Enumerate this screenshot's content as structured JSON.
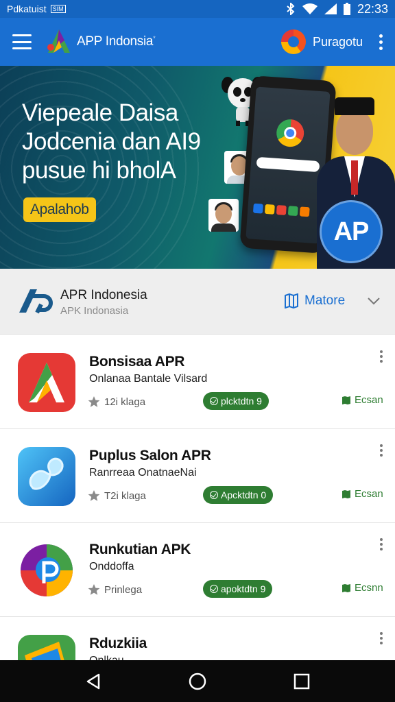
{
  "status_bar": {
    "carrier": "Pdkatuist",
    "sim_label": "SIM",
    "time": "22:33"
  },
  "app_bar": {
    "title": "APP Indonsia",
    "title_mark": "*",
    "user_name": "Puragotu"
  },
  "banner": {
    "headline": [
      "Viepeale Daisa",
      "Jodcenia dan AI9",
      "pusue hi bholA"
    ],
    "cta_label": "Apalahob",
    "badge_label": "AP"
  },
  "publisher": {
    "name": "APR Indonesia",
    "subtitle": "APK Indonasia",
    "more_label": "Matore"
  },
  "apps": [
    {
      "name": "Bonsisaa APR",
      "subtitle": "Onlanaa Bantale Vilsard",
      "rating": "12i klaga",
      "install": "plcktdtn 9",
      "action": "Ecsan",
      "accent": "#e53935"
    },
    {
      "name": "Puplus Salon APR",
      "subtitle": "Ranrreaa OnatnaeNai",
      "rating": "T2i klaga",
      "install": "Apcktdtn 0",
      "action": "Ecsan",
      "accent": "#1e88e5"
    },
    {
      "name": "Runkutian APK",
      "subtitle": "Onddoffa",
      "rating": "Prinlega",
      "install": "apoktdtn 9",
      "action": "Ecsnn",
      "accent": "#7b1fa2"
    },
    {
      "name": "Rduzkiia",
      "subtitle": "Onlkau",
      "rating": "",
      "install": "",
      "action": "",
      "accent": "#43a047"
    }
  ],
  "colors": {
    "primary": "#1a6fd1",
    "install_green": "#2e7d32",
    "banner_yellow": "#f5c518"
  },
  "icons": [
    "menu-icon",
    "logo-icon",
    "avatar-icon",
    "overflow-icon",
    "bookmark-icon",
    "chevron-down-icon",
    "star-icon",
    "check-icon",
    "book-icon",
    "back-icon",
    "home-icon",
    "recents-icon"
  ]
}
